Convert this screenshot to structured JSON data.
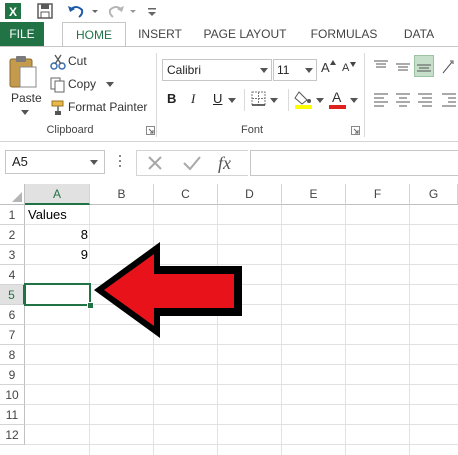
{
  "quick_access": {
    "icons": [
      "excel-logo-icon",
      "save-icon",
      "undo-icon",
      "redo-icon",
      "customize-qat-icon"
    ]
  },
  "tabs": [
    "FILE",
    "HOME",
    "INSERT",
    "PAGE LAYOUT",
    "FORMULAS",
    "DATA"
  ],
  "clipboard": {
    "paste_label": "Paste",
    "cut_label": "Cut",
    "copy_label": "Copy",
    "format_painter_label": "Format Painter",
    "group_label": "Clipboard"
  },
  "font": {
    "family": "Calibri",
    "size": "11",
    "bold": "B",
    "italic": "I",
    "underline": "U",
    "grow": "A",
    "shrink": "A",
    "font_color_glyph": "A",
    "group_label": "Font"
  },
  "formula_bar": {
    "name_box": "A5",
    "fx": "fx",
    "formula": ""
  },
  "sheet": {
    "columns": [
      "A",
      "B",
      "C",
      "D",
      "E",
      "F",
      "G"
    ],
    "rows": [
      "1",
      "2",
      "3",
      "4",
      "5",
      "6",
      "7",
      "8",
      "9",
      "10",
      "11",
      "12"
    ],
    "cells": {
      "A1": "Values",
      "A2": "8",
      "A3": "9"
    },
    "active_cell": "A5"
  },
  "colors": {
    "accent": "#217346",
    "arrow": "#e8121a",
    "fill_highlight": "#ffff00",
    "font_color": "#e0201f"
  }
}
